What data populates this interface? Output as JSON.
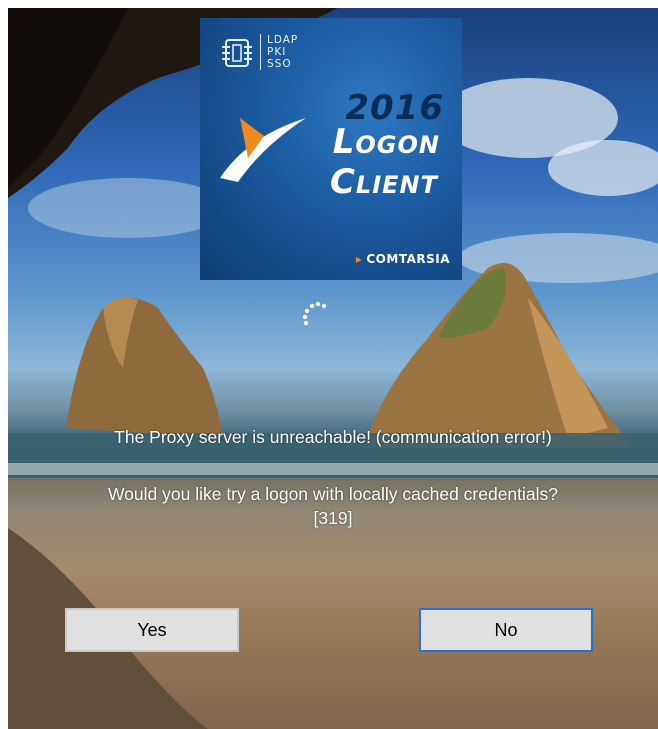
{
  "logo": {
    "chip_labels": [
      "LDAP",
      "PKI",
      "SSO"
    ],
    "year": "2016",
    "word_1": "Logon",
    "word_2": "Client",
    "brand": "COMTARSIA",
    "colors": {
      "tile": "#1b5a9f",
      "accent": "#f08a1c",
      "year": "#0b2c57"
    }
  },
  "status": {
    "spinner_icon": "loading-spinner-icon",
    "message_error": "The Proxy server is unreachable! (communication error!)",
    "message_question": "Would you like try a logon with locally cached credentials?",
    "message_code": "[319]"
  },
  "actions": {
    "yes_label": "Yes",
    "no_label": "No",
    "focus_color": "#2a6fc9"
  }
}
